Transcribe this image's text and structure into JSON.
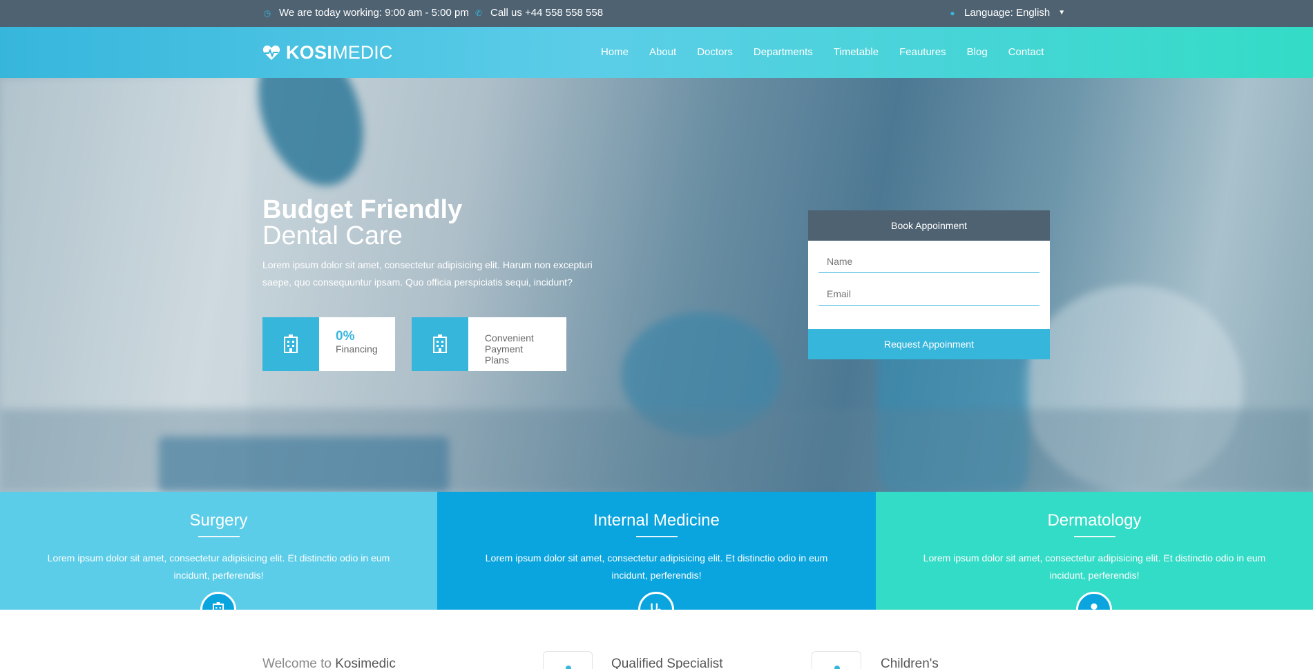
{
  "topbar": {
    "hours": "We are today working: 9:00 am - 5:00 pm",
    "phone": "Call us +44 558 558 558",
    "language": "Language: English"
  },
  "brand": {
    "bold": "KOSI",
    "light": "MEDIC"
  },
  "nav": [
    "Home",
    "About",
    "Doctors",
    "Departments",
    "Timetable",
    "Feautures",
    "Blog",
    "Contact"
  ],
  "hero": {
    "title_line1": "Budget Friendly",
    "title_line2": "Dental Care",
    "text": "Lorem ipsum dolor sit amet, consectetur adipisicing elit. Harum non excepturi saepe, quo consequuntur ipsam. Quo officia perspiciatis sequi, incidunt?",
    "features": [
      {
        "big": "0%",
        "small": "Financing",
        "icon": "hospital-icon"
      },
      {
        "line1": "Convenient",
        "line2": "Payment Plans",
        "icon": "hospital-icon"
      }
    ]
  },
  "appointment": {
    "title": "Book Appoinment",
    "name_placeholder": "Name",
    "email_placeholder": "Email",
    "button": "Request Appoinment"
  },
  "departments": [
    {
      "title": "Surgery",
      "text": "Lorem ipsum dolor sit amet, consectetur adipisicing elit. Et distinctio odio in eum incidunt, perferendis!",
      "icon": "hospital-icon"
    },
    {
      "title": "Internal Medicine",
      "text": "Lorem ipsum dolor sit amet, consectetur adipisicing elit. Et distinctio odio in eum incidunt, perferendis!",
      "icon": "stethoscope-icon"
    },
    {
      "title": "Dermatology",
      "text": "Lorem ipsum dolor sit amet, consectetur adipisicing elit. Et distinctio odio in eum incidunt, perferendis!",
      "icon": "doctor-icon"
    }
  ],
  "bottom": {
    "welcome_prefix": "Welcome to",
    "welcome_brand": "Kosimedic",
    "specialist": "Qualified Specialist",
    "children": "Children's"
  },
  "colors": {
    "accent": "#37b6dc",
    "topbar": "#4e6272",
    "dept_light": "#5bcde8",
    "dept_mid": "#0aa5df",
    "dept_teal": "#33dcc6"
  }
}
